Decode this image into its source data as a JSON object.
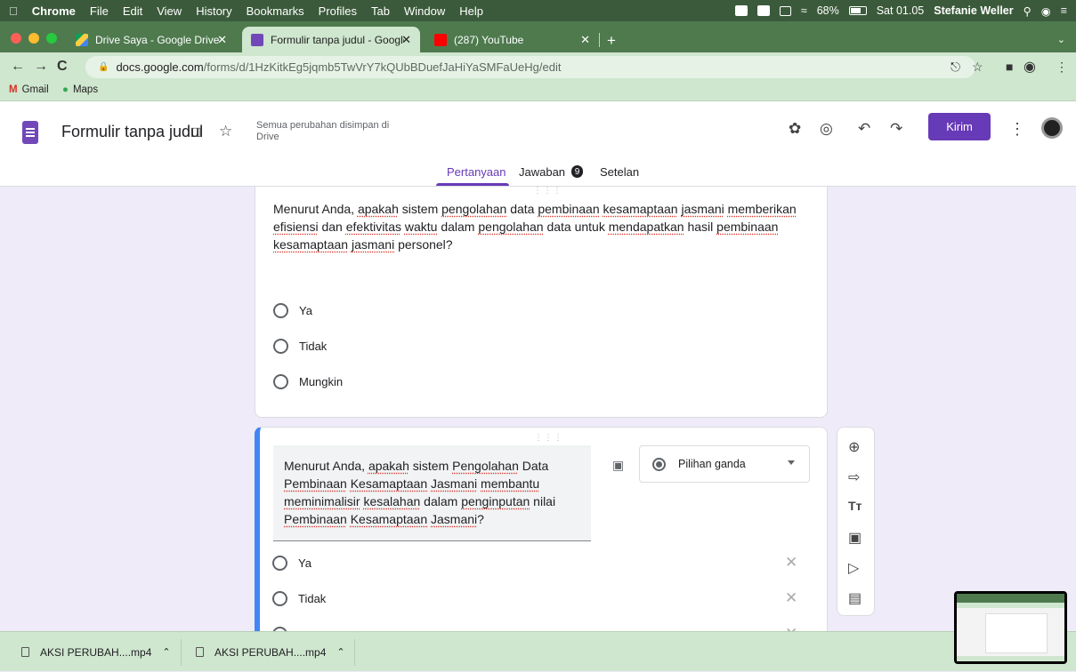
{
  "menubar": {
    "apple": "",
    "app": "Chrome",
    "items": [
      "File",
      "Edit",
      "View",
      "History",
      "Bookmarks",
      "Profiles",
      "Tab",
      "Window",
      "Help"
    ],
    "battery": "68%",
    "clock": "Sat 01.05",
    "user": "Stefanie Weller"
  },
  "tabs": [
    {
      "title": "Drive Saya - Google Drive"
    },
    {
      "title": "Formulir tanpa judul - Google F"
    },
    {
      "title": "(287) YouTube"
    }
  ],
  "address": {
    "host": "docs.google.com",
    "path": "/forms/d/1HzKitkEg5jqmb5TwVrY7kQUbBDuefJaHiYaSMFaUeHg/edit"
  },
  "bookmarks": [
    "Gmail",
    "Maps"
  ],
  "form": {
    "title": "Formulir tanpa judul",
    "saved_status": "Semua perubahan disimpan di Drive",
    "send_label": "Kirim",
    "tabs": {
      "questions": "Pertanyaan",
      "responses": "Jawaban",
      "responses_count": "9",
      "settings": "Setelan"
    }
  },
  "question1": {
    "text_parts": [
      "Menurut Anda, ",
      "apakah",
      " sistem ",
      "pengolahan",
      " data ",
      "pembinaan",
      " ",
      "kesamaptaan",
      " ",
      "jasmani",
      "  ",
      "memberikan",
      " ",
      "efisiensi",
      " dan ",
      "efektivitas",
      " ",
      "waktu",
      " dalam ",
      "pengolahan",
      " data untuk ",
      "mendapatkan",
      " hasil ",
      "pembinaan",
      " ",
      "kesamaptaan",
      " ",
      "jasmani",
      " personel?"
    ],
    "options": [
      "Ya",
      "Tidak",
      "Mungkin"
    ]
  },
  "question2": {
    "text_parts": [
      "Menurut Anda, ",
      "apakah",
      " sistem ",
      "Pengolahan",
      " Data ",
      "Pembinaan",
      " ",
      "Kesamaptaan",
      " ",
      "Jasmani",
      "  ",
      "membantu",
      " ",
      "meminimalisir",
      " ",
      "kesalahan",
      " dalam ",
      "penginputan",
      " nilai ",
      "Pembinaan",
      " ",
      "Kesamaptaan",
      " ",
      "Jasmani",
      "?"
    ],
    "type_label": "Pilihan ganda",
    "options": [
      "Ya",
      "Tidak"
    ]
  },
  "downloads": [
    {
      "name": "AKSI PERUBAH....mp4"
    },
    {
      "name": "AKSI PERUBAH....mp4"
    }
  ]
}
